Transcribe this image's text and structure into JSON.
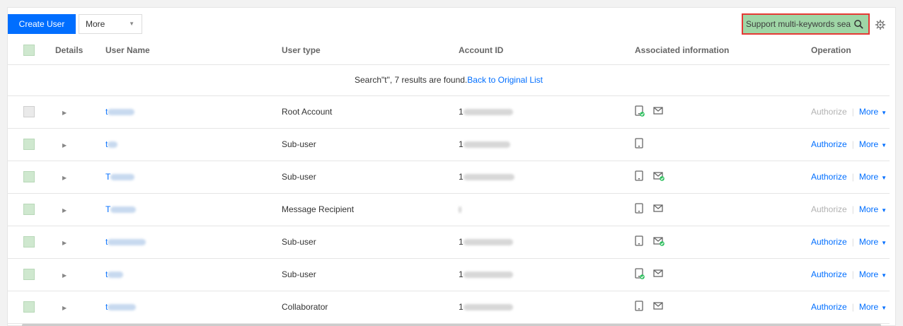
{
  "toolbar": {
    "create_label": "Create User",
    "more_label": "More",
    "search_placeholder": "Support multi-keywords search"
  },
  "table": {
    "headers": [
      "Details",
      "User Name",
      "User type",
      "Account ID",
      "Associated information",
      "Operation"
    ],
    "notice_text": "Search\"t\", 7 results are found.",
    "notice_link": "Back to Original List",
    "rows": [
      {
        "name": "t",
        "type": "Root Account",
        "account_id": "1",
        "phone": "phone-verified-icon",
        "mail": "mail-icon",
        "authorize_enabled": false
      },
      {
        "name": "t",
        "type": "Sub-user",
        "account_id": "1",
        "phone": "phone-icon",
        "mail": "",
        "authorize_enabled": true
      },
      {
        "name": "T",
        "type": "Sub-user",
        "account_id": "1",
        "phone": "phone-icon",
        "mail": "mail-verified-icon",
        "authorize_enabled": true
      },
      {
        "name": "T",
        "type": "Message Recipient",
        "account_id": "",
        "phone": "phone-icon",
        "mail": "mail-icon",
        "authorize_enabled": false
      },
      {
        "name": "t",
        "type": "Sub-user",
        "account_id": "1",
        "phone": "phone-icon",
        "mail": "mail-verified-icon",
        "authorize_enabled": true
      },
      {
        "name": "t",
        "type": "Sub-user",
        "account_id": "1",
        "phone": "phone-verified-icon",
        "mail": "mail-icon",
        "authorize_enabled": true
      },
      {
        "name": "t",
        "type": "Collaborator",
        "account_id": "1",
        "phone": "phone-icon",
        "mail": "mail-icon",
        "authorize_enabled": true
      }
    ],
    "authorize_label": "Authorize",
    "more_label": "More"
  },
  "colors": {
    "primary": "#006eff",
    "highlight": "#e53935",
    "verified": "#2bbf5c"
  }
}
